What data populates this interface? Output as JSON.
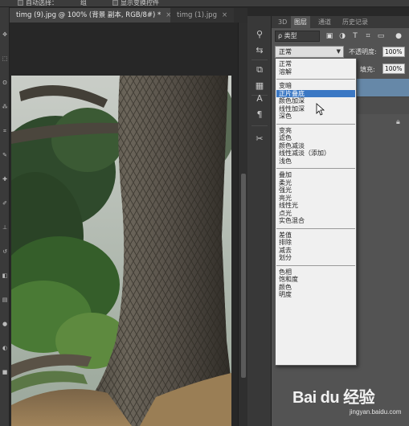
{
  "option_bar": {
    "auto_select_label": "自动选择：",
    "auto_select_value": "组",
    "show_transform_label": "显示变换控件"
  },
  "tabs": [
    {
      "label": "timg (9).jpg @ 100% (背景 副本, RGB/8#) *",
      "active": true
    },
    {
      "label": "timg (1).jpg",
      "active": false
    }
  ],
  "close_glyph": "×",
  "panel": {
    "tabs": [
      "3D",
      "图层",
      "通道",
      "历史记录"
    ],
    "filter_label": "ρ 类型",
    "blend_mode": "正常",
    "opacity_label": "不透明度:",
    "opacity_value": "100%",
    "fill_label": "填充:",
    "fill_value": "100%"
  },
  "blend_groups": [
    [
      "正常",
      "溶解"
    ],
    [
      "变暗",
      "正片叠底",
      "颜色加深",
      "线性加深",
      "深色"
    ],
    [
      "变亮",
      "滤色",
      "颜色减淡",
      "线性减淡（添加）",
      "浅色"
    ],
    [
      "叠加",
      "柔光",
      "强光",
      "亮光",
      "线性光",
      "点光",
      "实色混合"
    ],
    [
      "差值",
      "排除",
      "减去",
      "划分"
    ],
    [
      "色相",
      "饱和度",
      "颜色",
      "明度"
    ]
  ],
  "highlighted_item": "正片叠底",
  "watermark": {
    "main": "Bai du 经验",
    "sub": "jingyan.baidu.com"
  },
  "colors": {
    "highlight": "#3b78c4",
    "panel_bg": "#535353",
    "app_bg": "#282828"
  }
}
